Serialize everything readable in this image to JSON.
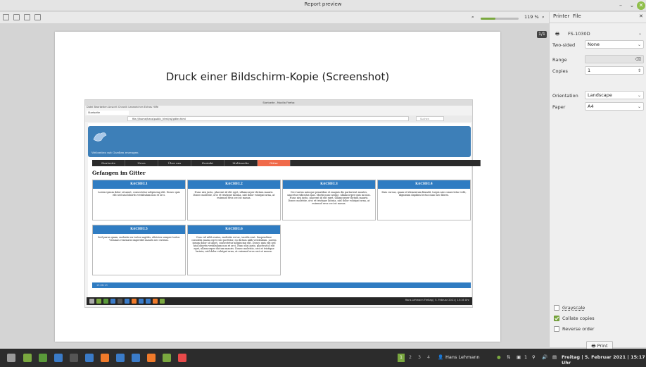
{
  "window": {
    "title": "Report preview"
  },
  "toolbar": {
    "zoom_label": "119 %",
    "zoom_fraction": 0.38,
    "page_badge": "1/1"
  },
  "document": {
    "heading": "Druck einer Bildschirm-Kopie (Screenshot)",
    "screenshot": {
      "browser_title": "Startseite - Mozilla Firefox",
      "menu": "Datei   Bearbeiten   Ansicht   Chronik   Lesezeichen   Extras   Hilfe",
      "tab_label": "Startseite",
      "url": "file:///home/hans/public_html/rsj/gitter.html",
      "search_placeholder": "Suchen",
      "banner_sub": "Webseiten mit Gardien erzeugen",
      "nav": [
        "Startseite",
        "News",
        "Über uns",
        "Kontakt",
        "Multimedia",
        "Gitter"
      ],
      "heading": "Gefangen im Gitter",
      "tiles": [
        {
          "title": "KACHEL1",
          "text": "Lorem ipsum dolor sit amet, consectetur adipiscing elit. Donec quis elit sed nisi lobortis vestibulum non et orci."
        },
        {
          "title": "KACHEL2",
          "text": "Nunc nisi justo, placerat id elit eget, ullamcorper dictum mauris. Donec molestie, orci et tristique lacinia, nisl dolor volutpat urna, at euismod eros orci ut massa."
        },
        {
          "title": "KACHEL3",
          "text": "Orci varius natoque penatibus et magnis dis parturient montes, nascetur ridiculus mus. Morbi nunc neque, ullamcorper quis mi non. Nunc nisi justo, placerat id elit eget, ullamcorper dictum mauris. Donec molestie, orci et tristique lacinia, nisl dolor volutpat urna, at euismod eros orci ut massa."
        },
        {
          "title": "KACHEL4",
          "text": "Duis cursus, quam id elementum blandit, turpis nisi consectetur velit, dignissim dapibus lectus nunc nec libero."
        },
        {
          "title": "KACHEL5",
          "text": "Sed purus quam, molestie eu tortor sagittis, ultricies semper tortor. Vivamus venenatis imperdiet mauris nec rutrum."
        },
        {
          "title": "KACHEL6",
          "text": "Cras vel nibh varius, molestie est ac, iaculis erat. Suspendisse convallis massa eget erat porttitor, eu dictum nibh vestibulum. Lorem ipsum dolor sit amet, consectetur adipiscing elit. Donec quis elit sed nisi lobortis vestibulum non et orci. Nunc nisi justo, placerat id elit eget, ullamcorper dictum mauris. Donec molestie, orci et tristique lacinia, nisl dolor volutpat urna, at euismod eros orci ut massa."
        }
      ],
      "footer_time": "15:06:13",
      "inner_clock": "Hans Lehmann   Freitag | 5. Februar 2021 | 15:16 Uhr"
    }
  },
  "side": {
    "tabs": [
      "Printer",
      "File"
    ],
    "printer": "FS-1030D",
    "two_sided_label": "Two-sided",
    "two_sided_value": "None",
    "range_label": "Range",
    "range_value": "",
    "copies_label": "Copies",
    "copies_value": "1",
    "orientation_label": "Orientation",
    "orientation_value": "Landscape",
    "paper_label": "Paper",
    "paper_value": "A4",
    "grayscale_label": "Grayscale",
    "grayscale_checked": false,
    "collate_label": "Collate copies",
    "collate_checked": true,
    "reverse_label": "Reverse order",
    "reverse_checked": false,
    "print_label": "Print"
  },
  "taskbar": {
    "workspaces": [
      "1",
      "2",
      "3",
      "4"
    ],
    "user": "Hans Lehmann",
    "network": "1",
    "clock": "Freitag | 5. Februar 2021 | 15:17 Uhr"
  }
}
